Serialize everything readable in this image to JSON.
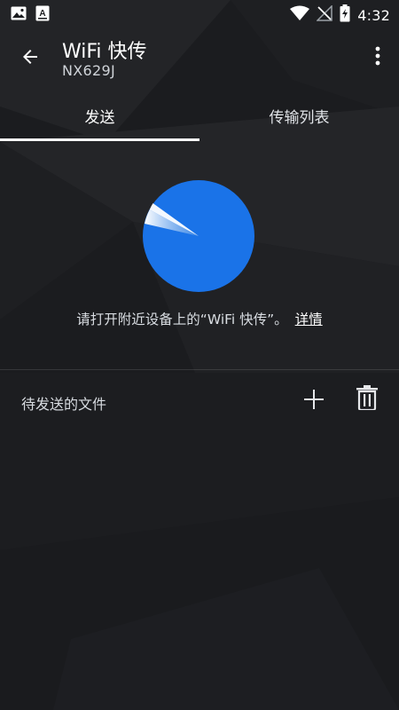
{
  "status_bar": {
    "time": "4:32",
    "left_icons": [
      "image-icon",
      "text-recognition-icon"
    ],
    "right_icons": [
      "wifi-icon",
      "no-signal-icon",
      "battery-charging-icon"
    ]
  },
  "app_bar": {
    "title": "WiFi 快传",
    "subtitle": "NX629J",
    "back_icon": "back-arrow-icon",
    "menu_icon": "more-vert-icon"
  },
  "tabs": [
    {
      "label": "发送",
      "selected": true
    },
    {
      "label": "传输列表",
      "selected": false
    }
  ],
  "radar": {
    "color": "#1a73e8"
  },
  "info": {
    "text": "请打开附近设备上的“WiFi 快传”。",
    "link": "详情"
  },
  "files": {
    "label": "待发送的文件",
    "add_icon": "add-icon",
    "delete_icon": "delete-icon"
  },
  "colors": {
    "accent": "#1a73e8",
    "background": "#1a1b1e"
  }
}
